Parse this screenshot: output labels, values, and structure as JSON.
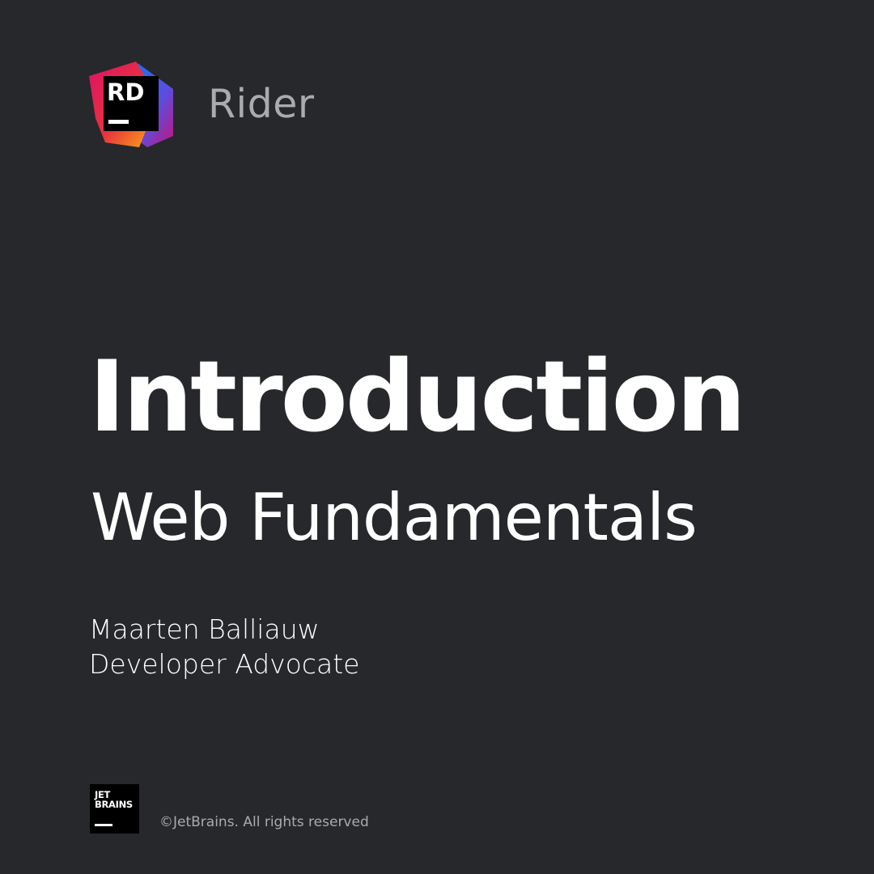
{
  "header": {
    "logo_text": "RD",
    "product_name": "Rider"
  },
  "main": {
    "title": "Introduction",
    "subtitle": "Web Fundamentals",
    "presenter_name": "Maarten Balliauw",
    "presenter_role": "Developer Advocate"
  },
  "footer": {
    "company_logo_line1": "JET",
    "company_logo_line2": "BRAINS",
    "copyright": "©JetBrains. All rights reserved"
  },
  "colors": {
    "background": "#26282b",
    "logo_magenta": "#dd1265",
    "logo_orange": "#fdb60d",
    "logo_blue": "#087cfa",
    "muted_text": "#a9abaf"
  }
}
